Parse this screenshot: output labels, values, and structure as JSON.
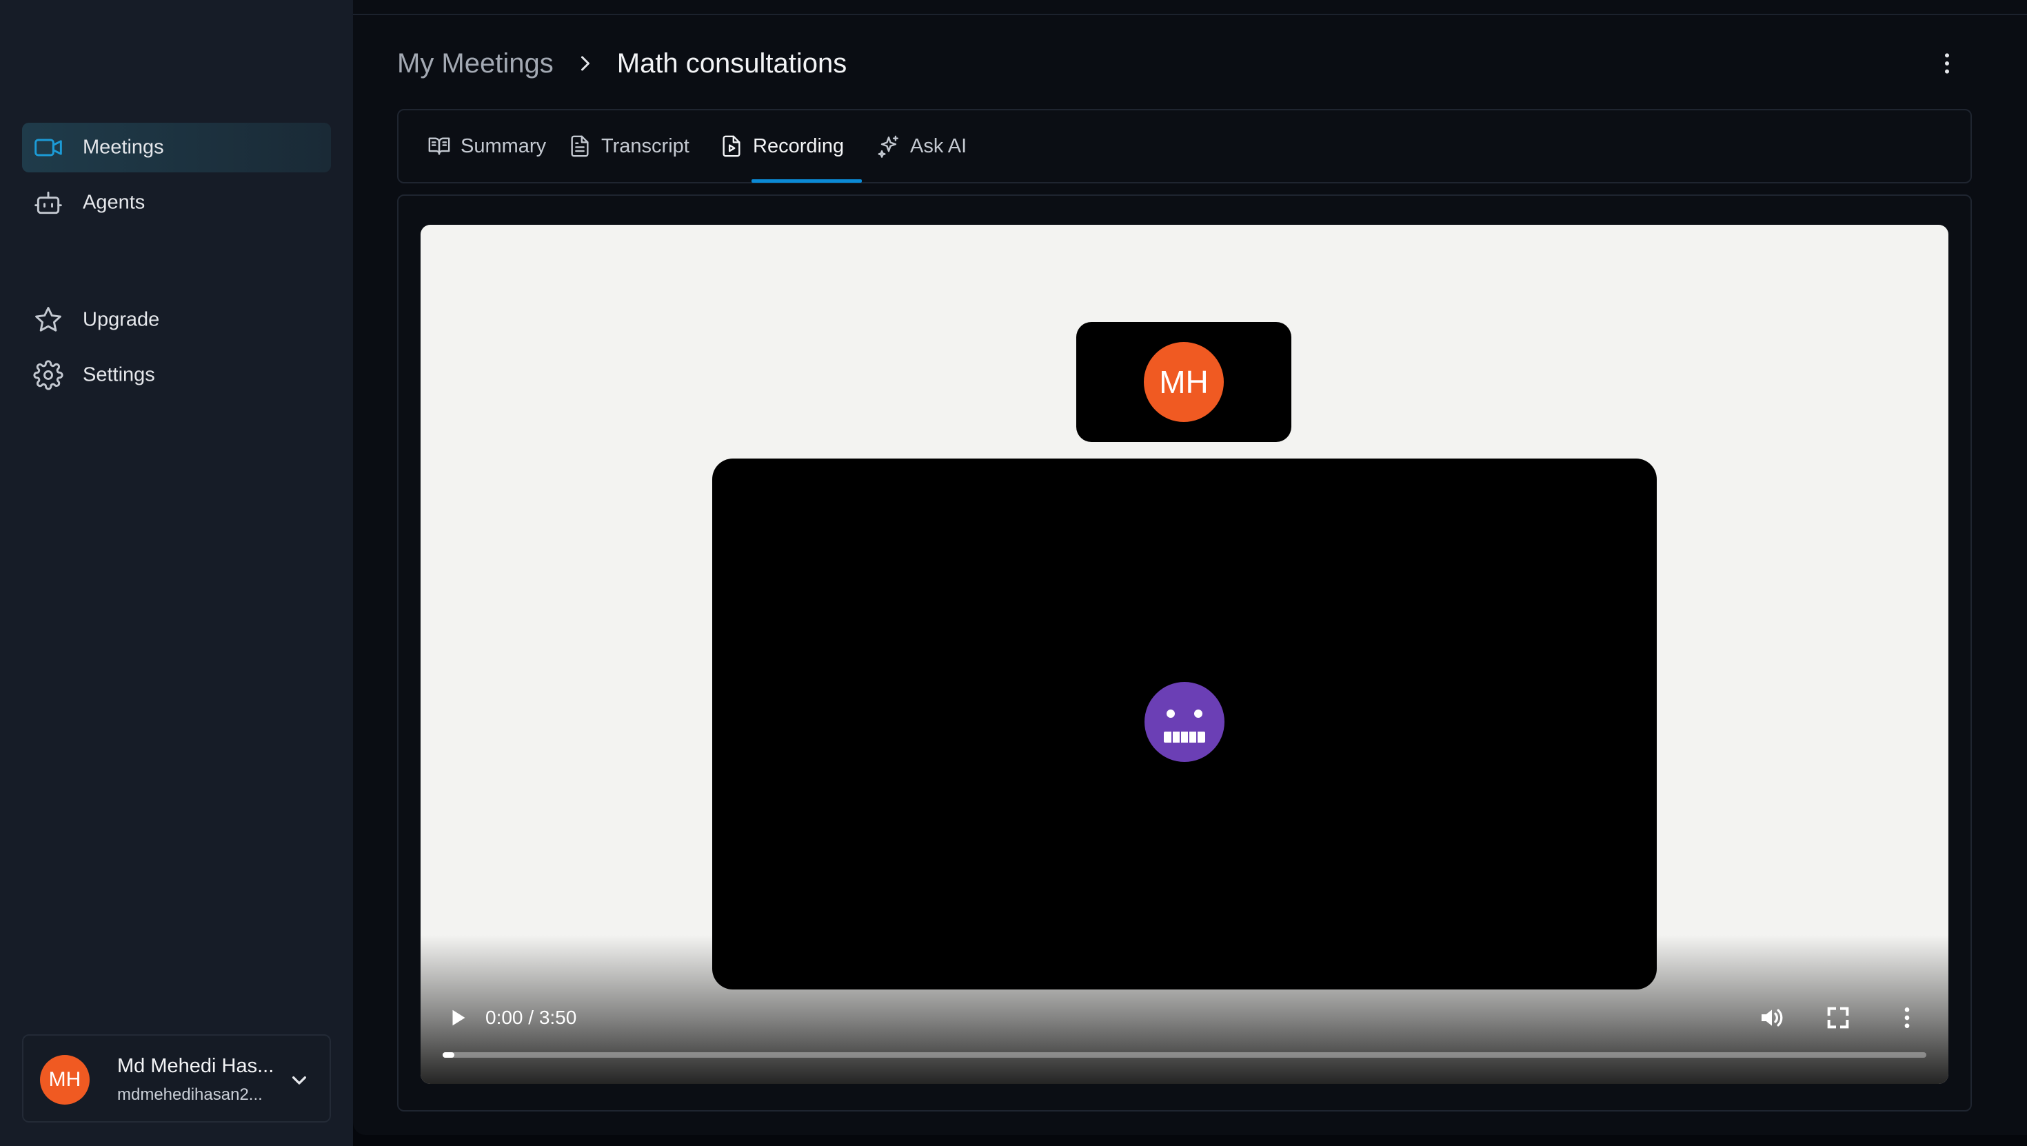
{
  "sidebar": {
    "nav_top": [
      {
        "label": "Meetings",
        "icon": "video-camera-icon",
        "active": true
      },
      {
        "label": "Agents",
        "icon": "bot-icon",
        "active": false
      }
    ],
    "nav_bottom": [
      {
        "label": "Upgrade",
        "icon": "star-icon"
      },
      {
        "label": "Settings",
        "icon": "gear-icon"
      }
    ],
    "user": {
      "initials": "MH",
      "name": "Md Mehedi Has...",
      "email": "mdmehedihasan2..."
    }
  },
  "header": {
    "breadcrumb_parent": "My Meetings",
    "breadcrumb_current": "Math consultations",
    "more_icon": "vertical-dots-icon"
  },
  "tabs": [
    {
      "label": "Summary",
      "icon": "book-open-icon",
      "active": false
    },
    {
      "label": "Transcript",
      "icon": "file-text-icon",
      "active": false
    },
    {
      "label": "Recording",
      "icon": "file-video-icon",
      "active": true
    },
    {
      "label": "Ask AI",
      "icon": "sparkles-icon",
      "active": false
    }
  ],
  "recording": {
    "participant_initials": "MH",
    "agent_avatar": "bot-face-icon",
    "player": {
      "time": "0:00 / 3:50",
      "progress_fraction": 0.004
    }
  },
  "colors": {
    "accent": "#0b8ad6",
    "avatar_orange": "#f05a22",
    "bot_purple": "#6b3fb5",
    "sidebar_bg": "#161c27",
    "main_bg": "#0a0d13"
  }
}
